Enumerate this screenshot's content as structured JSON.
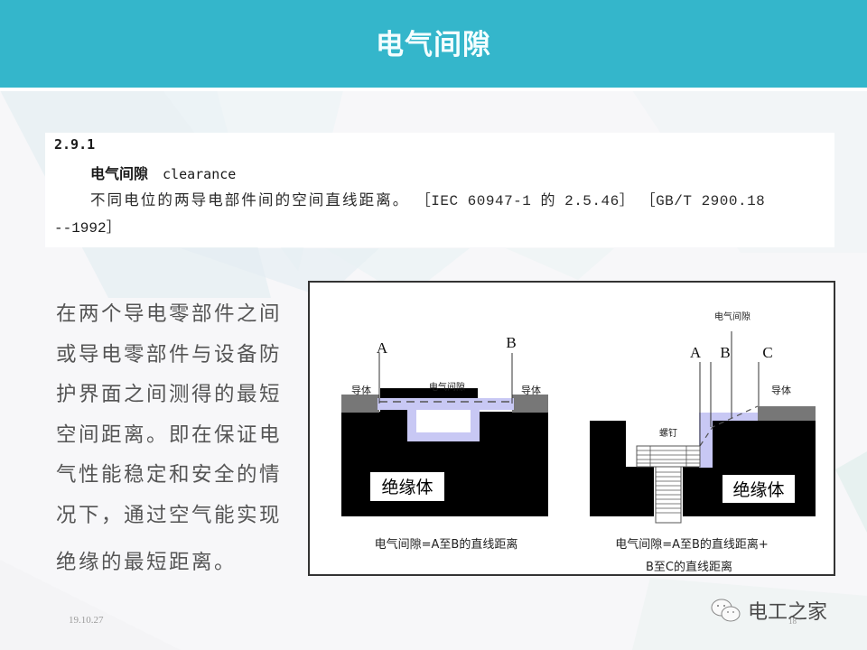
{
  "slide": {
    "title": "电气间隙",
    "colors": {
      "header": "#34b6cb",
      "header_text": "#f4feff",
      "insulator": "#000000",
      "conductor": "#7a7a7a",
      "clearance_highlight": "#c8c8f4"
    }
  },
  "definition": {
    "number": "2.9.1",
    "term_cn": "电气间隙",
    "term_en": "clearance",
    "body": "不同电位的两导电部件间的空间直线距离。",
    "ref1": "［IEC 60947-1 的 2.5.46］",
    "ref2": "［GB/T 2900.18",
    "ref2_cont": "--1992］"
  },
  "explanation": {
    "lines": [
      "在两个导电零部件之间",
      "或导电零部件与设备防",
      "护界面之间测得的最短",
      "空间距离。即在保证电",
      "气性能稳定和安全的情",
      "况下，通过空气能实现"
    ],
    "last_line": "绝缘的最短距离。"
  },
  "diagram": {
    "left": {
      "label_a": "A",
      "label_b": "B",
      "conductor_left": "导体",
      "conductor_right": "导体",
      "gap_label": "电气间隙",
      "insulator_label": "绝缘体",
      "caption": "电气间隙=A至B的直线距离"
    },
    "right": {
      "gap_label": "电气间隙",
      "label_a": "A",
      "label_b": "B",
      "label_c": "C",
      "conductor": "导体",
      "screw": "螺钉",
      "insulator_label": "绝缘体",
      "caption_line1": "电气间隙=A至B的直线距离+",
      "caption_line2": "B至C的直线距离"
    }
  },
  "footer": {
    "date": "19.10.27",
    "page": "18",
    "watermark": "电工之家",
    "watermark_icon": "wechat-icon"
  }
}
